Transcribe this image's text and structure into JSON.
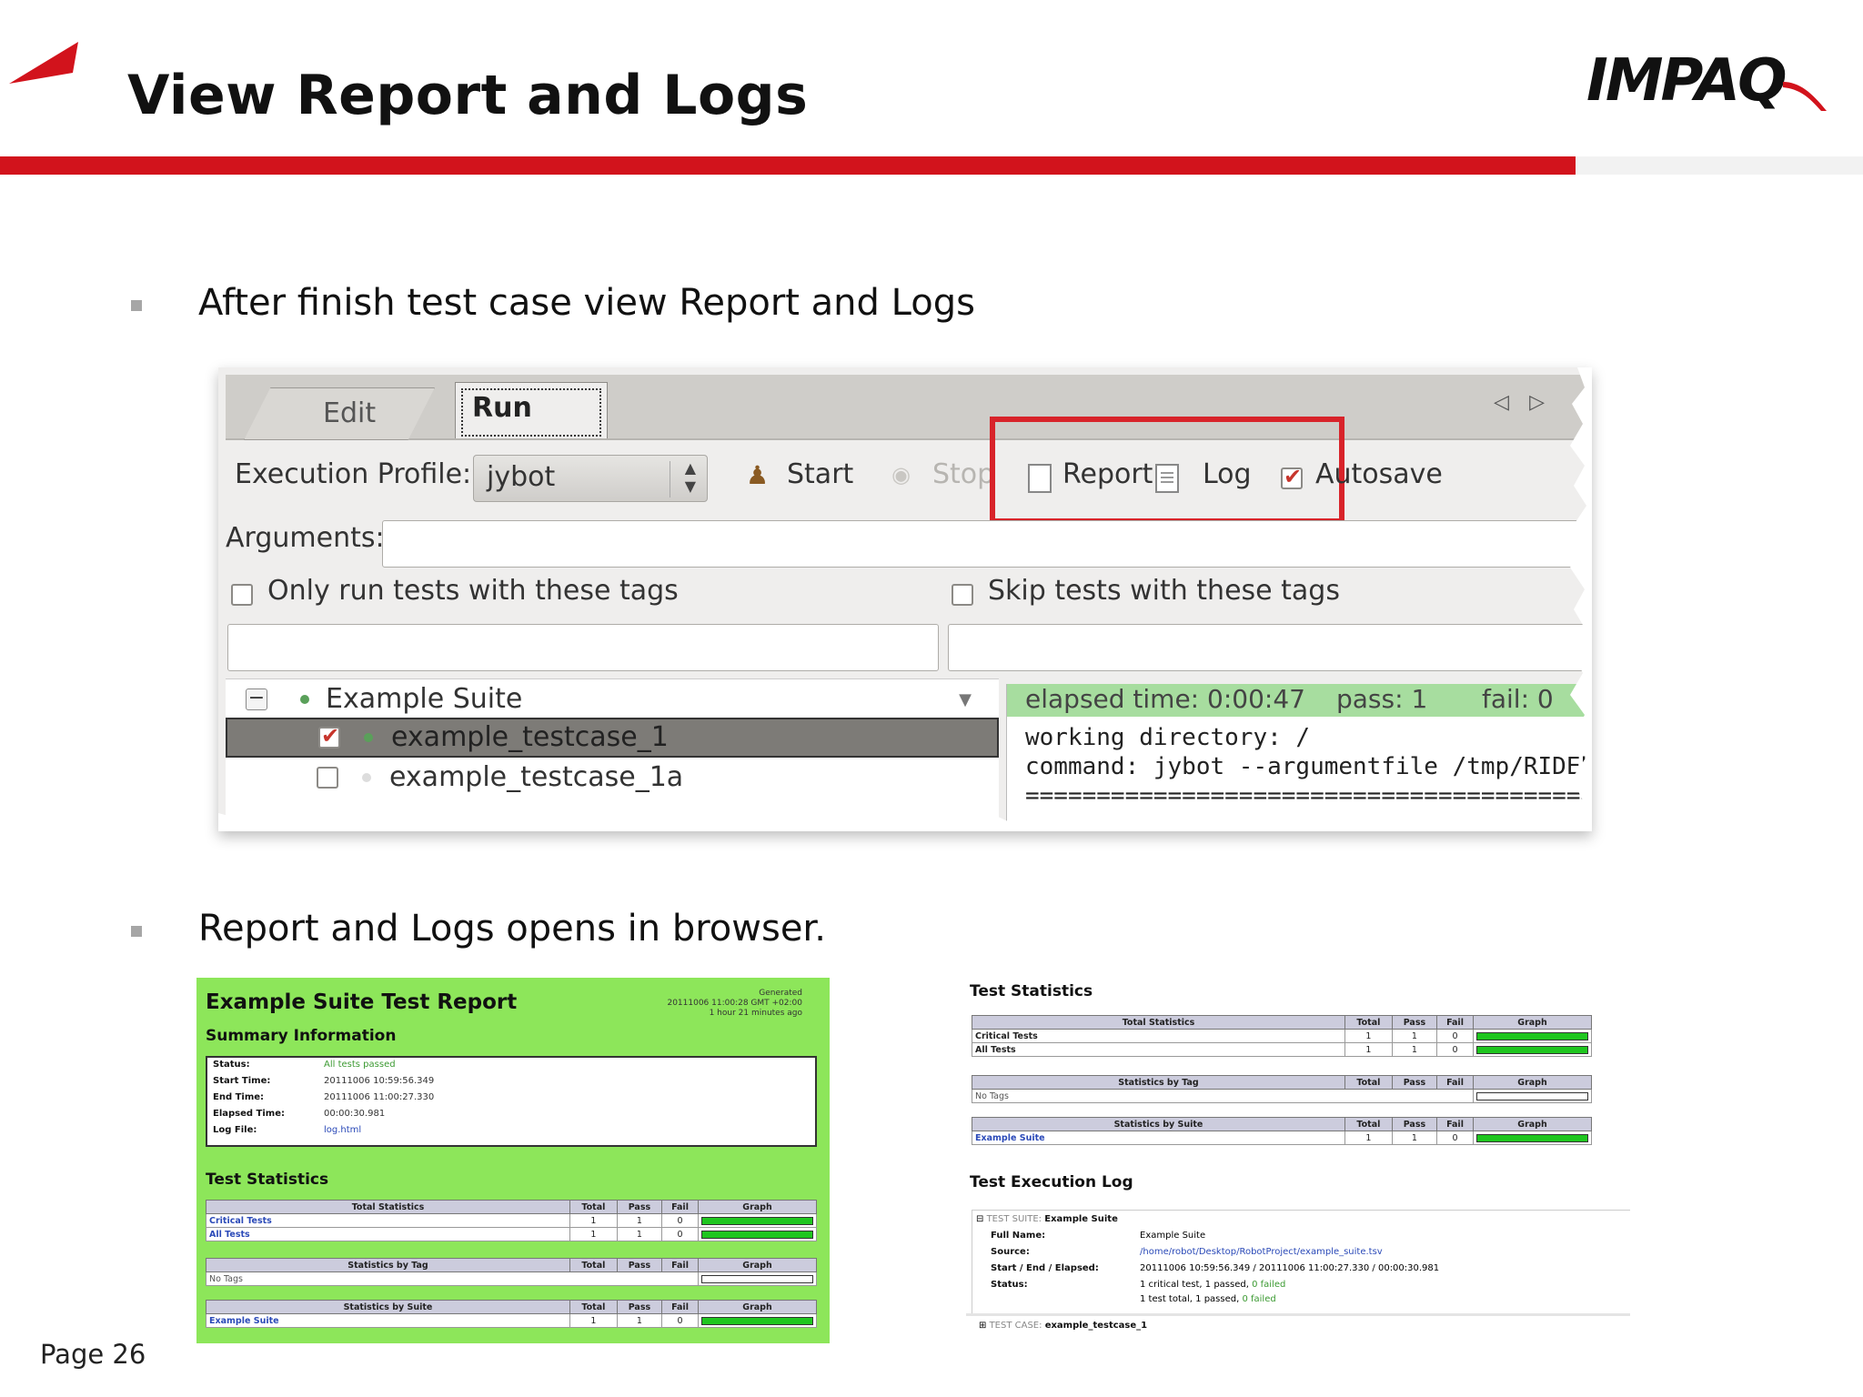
{
  "slide": {
    "title": "View Report and Logs",
    "logo": "IMPAQ",
    "page": "Page 26",
    "accent_color": "#d2131c"
  },
  "bullets": [
    "After finish test case view Report and Logs",
    "Report and Logs opens in browser."
  ],
  "ride": {
    "tabs": [
      "Edit",
      "Run"
    ],
    "active_tab": "Run",
    "execution_profile_label": "Execution Profile:",
    "execution_profile_value": "jybot",
    "start_label": "Start",
    "stop_label": "Stop",
    "report_label": "Report",
    "log_label": "Log",
    "autosave_label": "Autosave",
    "autosave_checked": true,
    "arguments_label": "Arguments:",
    "only_run_label": "Only run tests with these tags",
    "skip_label": "Skip tests with these tags",
    "tree": {
      "suite": "Example Suite",
      "tests": [
        {
          "name": "example_testcase_1",
          "checked": true,
          "selected": true
        },
        {
          "name": "example_testcase_1a",
          "checked": false,
          "selected": false
        }
      ]
    },
    "output": {
      "elapsed": "elapsed time: 0:00:47",
      "pass": "pass: 1",
      "fail": "fail: 0",
      "working_dir": "working directory: /",
      "command": "command: jybot --argumentfile /tmp/RIDEh",
      "separator": "=========================================="
    }
  },
  "report": {
    "title": "Example Suite Test Report",
    "generated": [
      "Generated",
      "20111006 11:00:28 GMT +02:00",
      "1 hour 21 minutes ago"
    ],
    "summary_title": "Summary Information",
    "summary": [
      {
        "label": "Status:",
        "value": "All tests passed",
        "style": "ok"
      },
      {
        "label": "Start Time:",
        "value": "20111006 10:59:56.349",
        "style": ""
      },
      {
        "label": "End Time:",
        "value": "20111006 11:00:27.330",
        "style": ""
      },
      {
        "label": "Elapsed Time:",
        "value": "00:00:30.981",
        "style": ""
      },
      {
        "label": "Log File:",
        "value": "log.html",
        "style": "link"
      }
    ],
    "stats_title": "Test Statistics"
  },
  "stats": {
    "headers": [
      "Total",
      "Pass",
      "Fail",
      "Graph"
    ],
    "total_title": "Total Statistics",
    "tag_title": "Statistics by Tag",
    "suite_title": "Statistics by Suite",
    "total_rows": [
      {
        "name": "Critical Tests",
        "total": "1",
        "pass": "1",
        "fail": "0"
      },
      {
        "name": "All Tests",
        "total": "1",
        "pass": "1",
        "fail": "0"
      }
    ],
    "tag_rows": [
      {
        "name": "No Tags"
      }
    ],
    "suite_rows": [
      {
        "name": "Example Suite",
        "total": "1",
        "pass": "1",
        "fail": "0"
      }
    ]
  },
  "log": {
    "stats_title": "Test Statistics",
    "exec_title": "Test Execution Log",
    "suite_tag": "TEST SUITE:",
    "suite_name": "Example Suite",
    "full_name_label": "Full Name:",
    "full_name": "Example Suite",
    "source_label": "Source:",
    "source": "/home/robot/Desktop/RobotProject/example_suite.tsv",
    "times_label": "Start / End / Elapsed:",
    "times": "20111006 10:59:56.349  /  20111006 11:00:27.330  /  00:00:30.981",
    "status_label": "Status:",
    "status_line1": "1 critical test, 1 passed,",
    "status_line1_fail": "0 failed",
    "status_line2": "1 test total, 1 passed,",
    "status_line2_fail": "0 failed",
    "case_tag": "TEST CASE:",
    "case_name": "example_testcase_1"
  }
}
